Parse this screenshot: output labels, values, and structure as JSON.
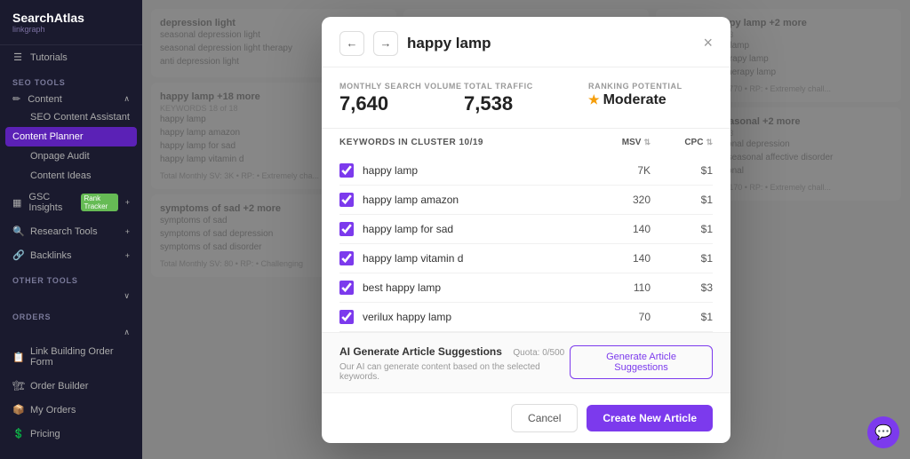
{
  "sidebar": {
    "brand": "SearchAtlas",
    "sub": "linkgraph",
    "sections": [
      {
        "label": "SEO TOOLS",
        "items": [
          {
            "id": "content",
            "label": "Content",
            "icon": "✏",
            "hasArrow": true
          },
          {
            "id": "seo-content-assistant",
            "label": "SEO Content Assistant",
            "sub": true
          },
          {
            "id": "content-planner",
            "label": "Content Planner",
            "sub": true,
            "active": true
          },
          {
            "id": "onpage-audit",
            "label": "Onpage Audit",
            "sub": true
          },
          {
            "id": "content-ideas",
            "label": "Content Ideas",
            "sub": true
          },
          {
            "id": "gsc-insights",
            "label": "GSC Insights",
            "icon": "📊",
            "badge": "Rank Tracker",
            "hasArrow": true
          },
          {
            "id": "research-tools",
            "label": "Research Tools",
            "icon": "🔍",
            "hasArrow": true
          },
          {
            "id": "backlinks",
            "label": "Backlinks",
            "icon": "🔗",
            "hasArrow": true
          }
        ]
      },
      {
        "label": "OTHER TOOLS",
        "items": []
      },
      {
        "label": "ORDERS",
        "items": [
          {
            "id": "link-building",
            "label": "Link Building Order Form",
            "icon": "📋"
          },
          {
            "id": "order-builder",
            "label": "Order Builder",
            "icon": "🏗"
          },
          {
            "id": "my-orders",
            "label": "My Orders",
            "icon": "📦"
          },
          {
            "id": "pricing",
            "label": "Pricing",
            "icon": "💲"
          }
        ]
      }
    ]
  },
  "modal": {
    "title": "happy lamp",
    "close_label": "×",
    "stats": {
      "monthly_search_volume": {
        "label": "MONTHLY SEARCH VOLUME",
        "value": "7,640"
      },
      "total_traffic": {
        "label": "TOTAL TRAFFIC",
        "value": "7,538"
      },
      "ranking_potential": {
        "label": "RANKING POTENTIAL",
        "value": "Moderate"
      }
    },
    "cluster_header": "KEYWORDS IN CLUSTER 10/19",
    "col_msv": "MSV",
    "col_cpc": "CPC",
    "keywords": [
      {
        "name": "happy lamp",
        "msv": "7K",
        "cpc": "$1",
        "checked": true
      },
      {
        "name": "happy lamp amazon",
        "msv": "320",
        "cpc": "$1",
        "checked": true
      },
      {
        "name": "happy lamp for sad",
        "msv": "140",
        "cpc": "$1",
        "checked": true
      },
      {
        "name": "happy lamp vitamin d",
        "msv": "140",
        "cpc": "$1",
        "checked": true
      },
      {
        "name": "best happy lamp",
        "msv": "110",
        "cpc": "$3",
        "checked": true
      },
      {
        "name": "verilux happy lamp",
        "msv": "70",
        "cpc": "$1",
        "checked": true
      }
    ],
    "ai_section": {
      "title": "AI Generate Article Suggestions",
      "quota": "Quota: 0/500",
      "description": "Our AI can generate content based on the selected keywords.",
      "suggest_btn": "Generate Article Suggestions"
    },
    "footer": {
      "cancel": "Cancel",
      "create": "Create New Article"
    }
  },
  "tutorials_label": "Tutorials"
}
